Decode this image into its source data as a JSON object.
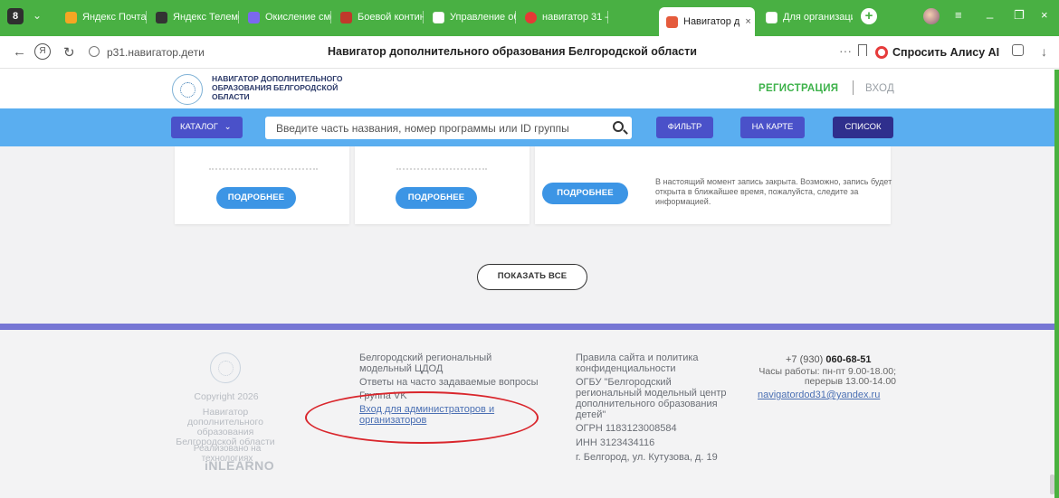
{
  "browser": {
    "tab_counter": "8",
    "tabs": [
      {
        "label": "Яндекс Почта",
        "favicon_color": "#f5a623"
      },
      {
        "label": "Яндекс Телемос",
        "favicon_color": "#333333"
      },
      {
        "label": "Окисление смес",
        "favicon_color": "#7b68ee"
      },
      {
        "label": "Боевой контине",
        "favicon_color": "#c0392b"
      },
      {
        "label": "Управление обр",
        "favicon_color": "#ffffff"
      },
      {
        "label": "навигатор 31 –",
        "favicon_color": "#e53935"
      },
      {
        "label": "Навигатор д",
        "favicon_color": "#e55b3c",
        "active": true
      },
      {
        "label": "Для организаци",
        "favicon_color": "#ffffff"
      }
    ],
    "tab_close": "×",
    "new_tab": "+",
    "window_controls": {
      "menu": "≡",
      "minimize": "_",
      "restore": "❐",
      "close": "×"
    },
    "address": {
      "back": "←",
      "home": "Я",
      "reload": "↻",
      "url": "р31.навигатор.дети",
      "page_title": "Навигатор дополнительного образования Белгородской области",
      "dots": "···",
      "alice_label": "Спросить Алису AI",
      "download": "↓"
    }
  },
  "site": {
    "logo_text": "Навигатор дополнительного образования Белгородской области",
    "register": "РЕГИСТРАЦИЯ",
    "login": "ВХОД",
    "toolbar": {
      "catalog": "КАТАЛОГ",
      "catalog_chevron": "⌄",
      "search_placeholder": "Введите часть названия, номер программы или ID группы",
      "filter": "ФИЛЬТР",
      "map": "НА КАРТЕ",
      "list": "СПИСОК"
    },
    "cards": [
      {
        "button": "ПОДРОБНЕЕ"
      },
      {
        "button": "ПОДРОБНЕЕ"
      },
      {
        "button": "ПОДРОБНЕЕ",
        "note": "В настоящий момент запись закрыта. Возможно, запись будет открыта в ближайшее время, пожалуйста, следите за информацией."
      }
    ],
    "show_all": "ПОКАЗАТЬ ВСЕ",
    "footer": {
      "copyright": "Copyright 2026",
      "nav_name": "Навигатор дополнительного образования Белгородской области",
      "tech_label": "Реализовано на технологиях",
      "tech_brand": "iNLEARNO",
      "col1": {
        "center_name": "Белгородский региональный модельный ЦДОД",
        "faq": "Ответы на часто задаваемые вопросы",
        "vk": "Группа VK",
        "admin_login": "Вход для администраторов и организаторов"
      },
      "col2": {
        "rules": "Правила сайта и политика конфиденциальности",
        "org": "ОГБУ \"Белгородский региональный модельный центр дополнительного образования детей\"",
        "ogrn": "ОГРН 1183123008584",
        "inn": "ИНН 3123434116",
        "address": "г. Белгород, ул. Кутузова, д. 19"
      },
      "contacts": {
        "phone_prefix": "+7 (930) ",
        "phone_bold": "060-68-51",
        "hours": "Часы работы: пн-пт 9.00-18.00; перерыв 13.00-14.00",
        "email": "navigatordod31@yandex.ru"
      }
    }
  }
}
